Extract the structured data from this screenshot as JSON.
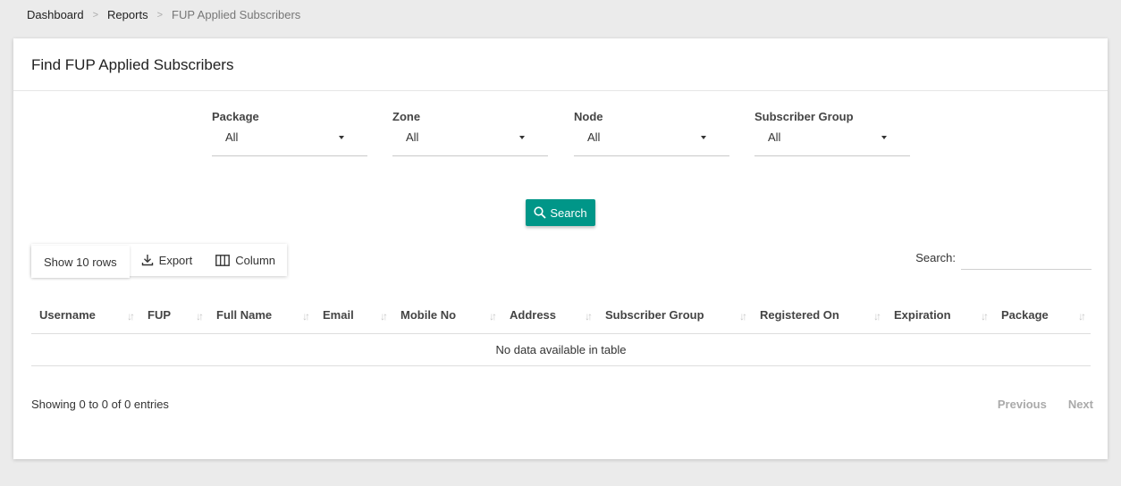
{
  "breadcrumb": {
    "items": [
      "Dashboard",
      "Reports"
    ],
    "separator": ">",
    "current": "FUP Applied Subscribers"
  },
  "card": {
    "title": "Find FUP Applied Subscribers"
  },
  "filters": [
    {
      "label": "Package",
      "value": "All"
    },
    {
      "label": "Zone",
      "value": "All"
    },
    {
      "label": "Node",
      "value": "All"
    },
    {
      "label": "Subscriber Group",
      "value": "All"
    }
  ],
  "search_button": {
    "label": "Search",
    "icon": "search-icon",
    "color": "#009688"
  },
  "toolbar": {
    "show_rows": "Show 10 rows",
    "export": "Export",
    "column": "Column"
  },
  "table_search": {
    "label": "Search:"
  },
  "table": {
    "columns": [
      "Username",
      "FUP",
      "Full Name",
      "Email",
      "Mobile No",
      "Address",
      "Subscriber Group",
      "Registered On",
      "Expiration",
      "Package"
    ],
    "empty_message": "No data available in table"
  },
  "footer": {
    "info": "Showing 0 to 0 of 0 entries",
    "previous": "Previous",
    "next": "Next"
  }
}
